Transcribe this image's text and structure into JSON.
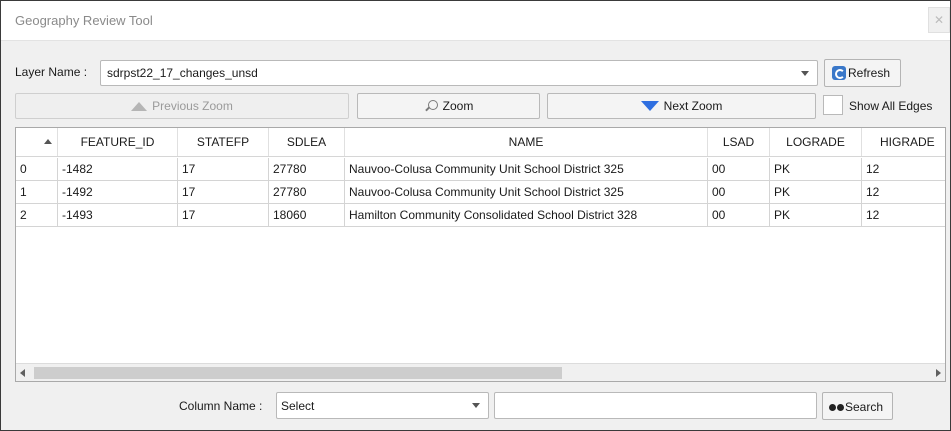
{
  "window": {
    "title": "Geography Review Tool",
    "close_glyph": "✕"
  },
  "layer": {
    "label": "Layer Name :",
    "value": "sdrpst22_17_changes_unsd",
    "refresh_label": "Refresh"
  },
  "toolbar": {
    "previous_zoom_label": "Previous Zoom",
    "zoom_label": "Zoom",
    "next_zoom_label": "Next Zoom",
    "show_all_edges_label": "Show All Edges",
    "show_all_edges_checked": false
  },
  "table": {
    "columns": [
      "",
      "FEATURE_ID",
      "STATEFP",
      "SDLEA",
      "NAME",
      "LSAD",
      "LOGRADE",
      "HIGRADE"
    ],
    "sorted_column_index": 0,
    "rows": [
      [
        "0",
        "-1482",
        "17",
        "27780",
        "Nauvoo-Colusa Community Unit School District 325",
        "00",
        "PK",
        "12"
      ],
      [
        "1",
        "-1492",
        "17",
        "27780",
        "Nauvoo-Colusa Community Unit School District 325",
        "00",
        "PK",
        "12"
      ],
      [
        "2",
        "-1493",
        "17",
        "18060",
        "Hamilton Community Consolidated School District 328",
        "00",
        "PK",
        "12"
      ]
    ]
  },
  "search": {
    "column_label": "Column Name :",
    "column_value": "Select",
    "query": "",
    "button_label": "Search"
  },
  "icons": {
    "refresh": "refresh-icon",
    "previous_zoom": "mountain-icon",
    "zoom": "magnifier-icon",
    "next_zoom": "down-triangle-icon",
    "search": "binoculars-icon"
  },
  "colors": {
    "next_zoom_icon": "#2f6fe0",
    "refresh_icon": "#3a78c9"
  }
}
